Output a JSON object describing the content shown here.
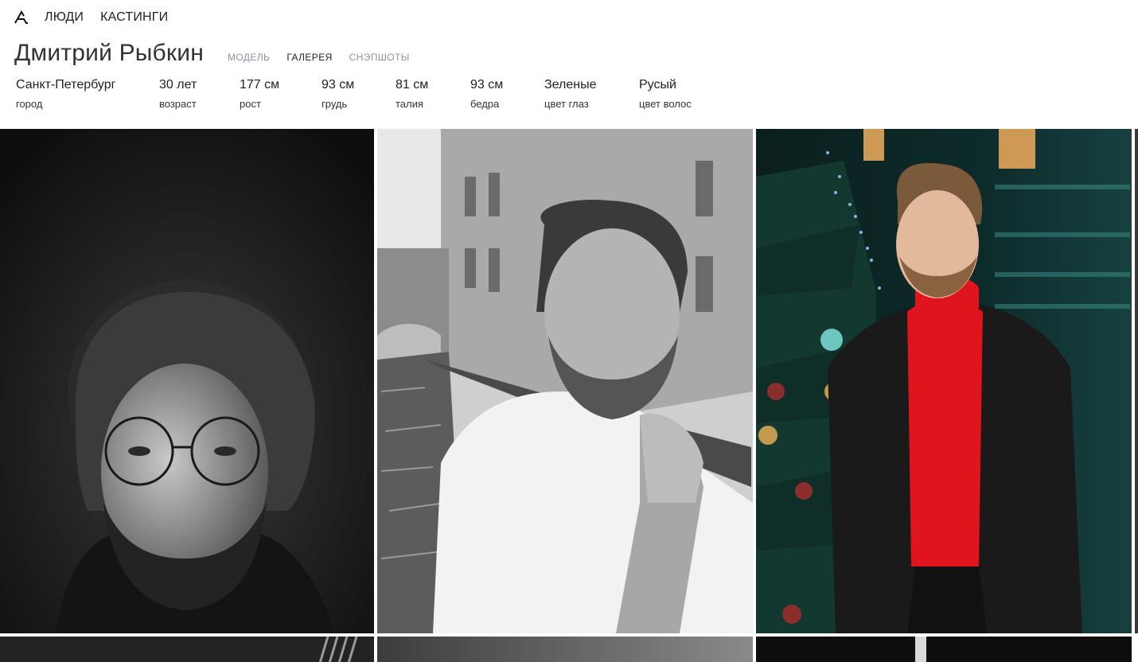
{
  "nav": {
    "logo_icon": "agency-logo-icon",
    "links": [
      "ЛЮДИ",
      "КАСТИНГИ"
    ]
  },
  "profile": {
    "name": "Дмитрий Рыбкин",
    "tabs": [
      {
        "label": "МОДЕЛЬ",
        "active": false
      },
      {
        "label": "ГАЛЕРЕЯ",
        "active": true
      },
      {
        "label": "СНЭПШОТЫ",
        "active": false
      }
    ],
    "stats": [
      {
        "value": "Санкт-Петербург",
        "label": "город"
      },
      {
        "value": "30 лет",
        "label": "возраст"
      },
      {
        "value": "177 см",
        "label": "рост"
      },
      {
        "value": "93 см",
        "label": "грудь"
      },
      {
        "value": "81 см",
        "label": "талия"
      },
      {
        "value": "93 см",
        "label": "бедра"
      },
      {
        "value": "Зеленые",
        "label": "цвет глаз"
      },
      {
        "value": "Русый",
        "label": "цвет волос"
      }
    ]
  },
  "colors": {
    "tab_active": "#222222",
    "tab_inactive": "#8a94a2",
    "sweater_red": "#e0141c"
  },
  "gallery": {
    "photos": [
      "bw-portrait-glasses",
      "bw-portrait-canal",
      "color-portrait-christmas-tree",
      "bw-photo-partial-1",
      "bw-photo-partial-2",
      "bw-photo-partial-3"
    ]
  }
}
